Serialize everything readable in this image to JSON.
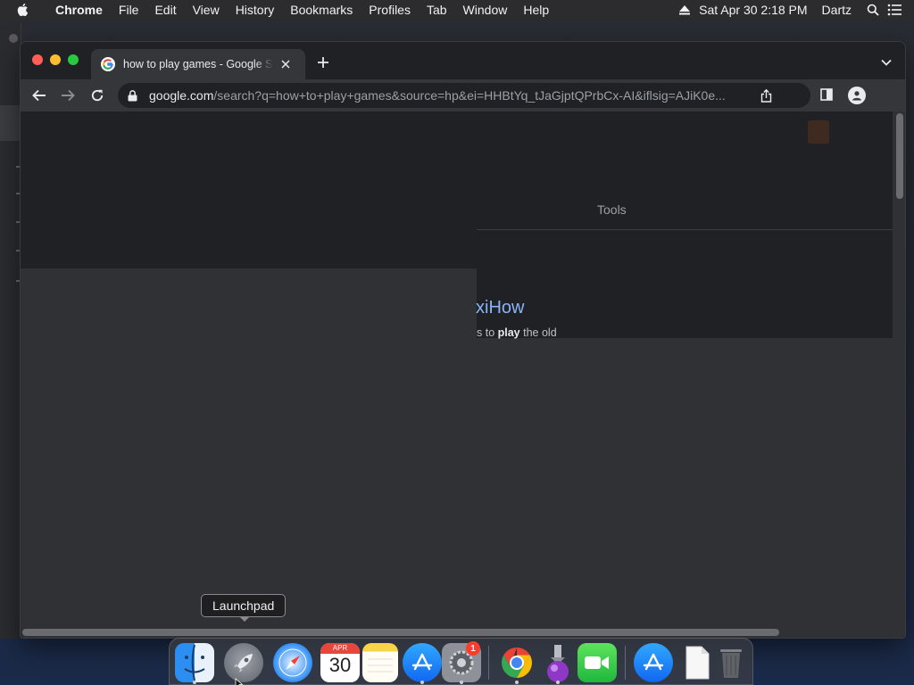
{
  "menubar": {
    "app_name": "Chrome",
    "items": [
      "File",
      "Edit",
      "View",
      "History",
      "Bookmarks",
      "Profiles",
      "Tab",
      "Window",
      "Help"
    ],
    "datetime": "Sat Apr 30  2:18 PM",
    "user": "Dartz",
    "icons": [
      "apple-icon",
      "eject-icon",
      "spotlight-search-icon",
      "control-center-icon"
    ]
  },
  "browser": {
    "tab": {
      "title": "how to play games - Google Search",
      "favicon": "google-favicon-icon"
    },
    "address_bar": {
      "domain": "google.com",
      "path": "/search?q=how+to+play+games&source=hp&ei=HHBtYq_tJaGjptQPrbCx-AI&iflsig=AJiK0e..."
    },
    "page": {
      "tools_label": "Tools",
      "result_title_visible": "xiHow",
      "snippet_prefix": "s to ",
      "snippet_bold": "play",
      "snippet_suffix": " the old"
    }
  },
  "tooltip": {
    "label": "Launchpad"
  },
  "dock": {
    "apps": [
      {
        "name": "Finder",
        "icon": "finder-icon",
        "running": true
      },
      {
        "name": "Launchpad",
        "icon": "launchpad-icon",
        "running": false
      },
      {
        "name": "Safari",
        "icon": "safari-icon",
        "running": false
      },
      {
        "name": "Calendar",
        "icon": "calendar-icon",
        "running": false,
        "month": "APR",
        "day": "30"
      },
      {
        "name": "Notes",
        "icon": "notes-icon",
        "running": false
      },
      {
        "name": "App Store",
        "icon": "app-store-icon",
        "running": true
      },
      {
        "name": "System Preferences",
        "icon": "system-preferences-icon",
        "running": true,
        "badge": "1"
      },
      {
        "name": "Google Chrome",
        "icon": "chrome-icon",
        "running": true
      },
      {
        "name": "Installer",
        "icon": "installer-icon",
        "running": true
      },
      {
        "name": "FaceTime",
        "icon": "facetime-icon",
        "running": false
      },
      {
        "name": "App Store (Downloads)",
        "icon": "app-store-icon",
        "running": false
      },
      {
        "name": "Document",
        "icon": "document-icon",
        "running": false
      },
      {
        "name": "Trash",
        "icon": "trash-icon",
        "running": false
      }
    ]
  },
  "colors": {
    "chrome_dark_bg": "#202124",
    "toolbar": "#35363a",
    "link_blue": "#8ab4f8",
    "badge_red": "#ff3b30"
  }
}
